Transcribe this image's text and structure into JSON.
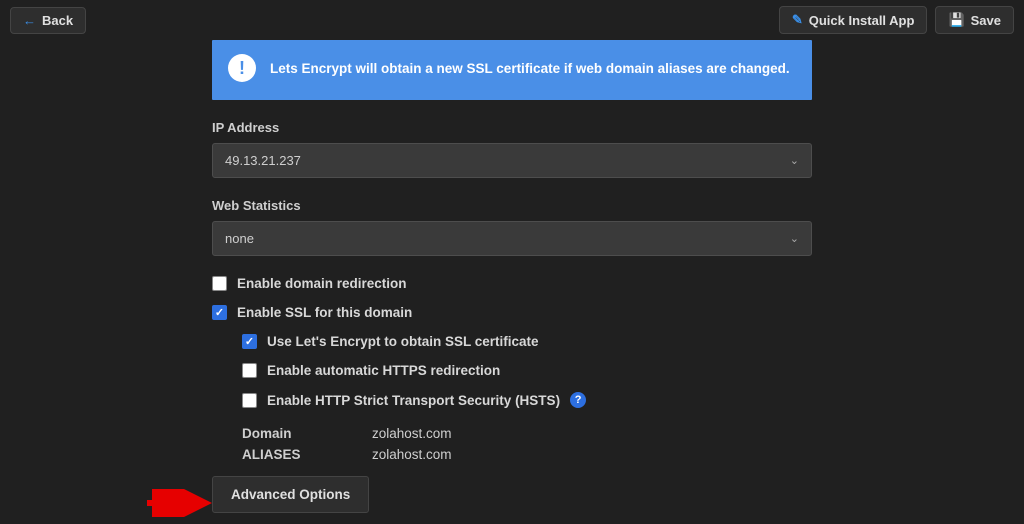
{
  "topbar": {
    "back": "Back",
    "quick_install": "Quick Install App",
    "save": "Save"
  },
  "banner": {
    "text": "Lets Encrypt will obtain a new SSL certificate if web domain aliases are changed."
  },
  "ip": {
    "label": "IP Address",
    "value": "49.13.21.237"
  },
  "webstats": {
    "label": "Web Statistics",
    "value": "none"
  },
  "checks": {
    "redirect": {
      "label": "Enable domain redirection",
      "checked": false
    },
    "ssl": {
      "label": "Enable SSL for this domain",
      "checked": true
    },
    "letsencrypt": {
      "label": "Use Let's Encrypt to obtain SSL certificate",
      "checked": true
    },
    "https_redirect": {
      "label": "Enable automatic HTTPS redirection",
      "checked": false
    },
    "hsts": {
      "label": "Enable HTTP Strict Transport Security (HSTS)",
      "checked": false
    }
  },
  "kv": {
    "domain_label": "Domain",
    "domain_value": "zolahost.com",
    "aliases_label": "ALIASES",
    "aliases_value": "zolahost.com"
  },
  "advanced": "Advanced Options"
}
